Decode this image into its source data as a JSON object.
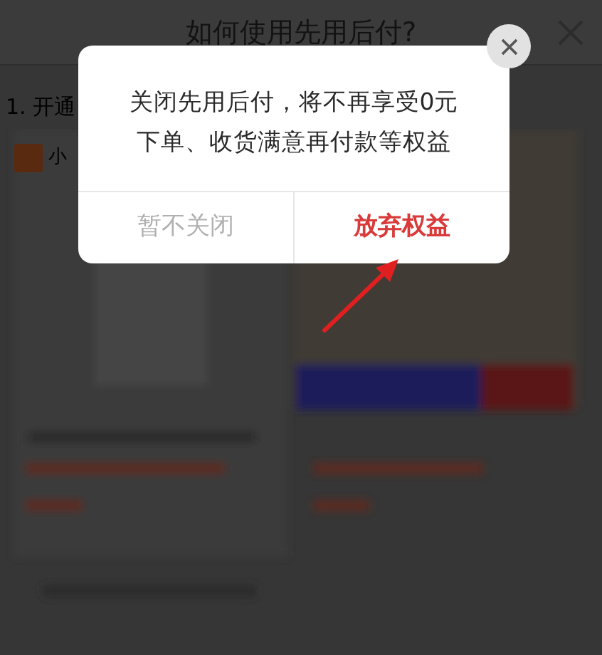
{
  "page": {
    "title": "如何使用先用后付?",
    "step_text": "1. 开通",
    "shop_name": "小"
  },
  "dialog": {
    "message_lines": [
      "关闭先用后付，将不再享受0元",
      "下单、收货满意再付款等权益"
    ],
    "buttons": [
      {
        "label": "暂不关闭",
        "kind": "secondary"
      },
      {
        "label": "放弃权益",
        "kind": "primary"
      }
    ]
  }
}
